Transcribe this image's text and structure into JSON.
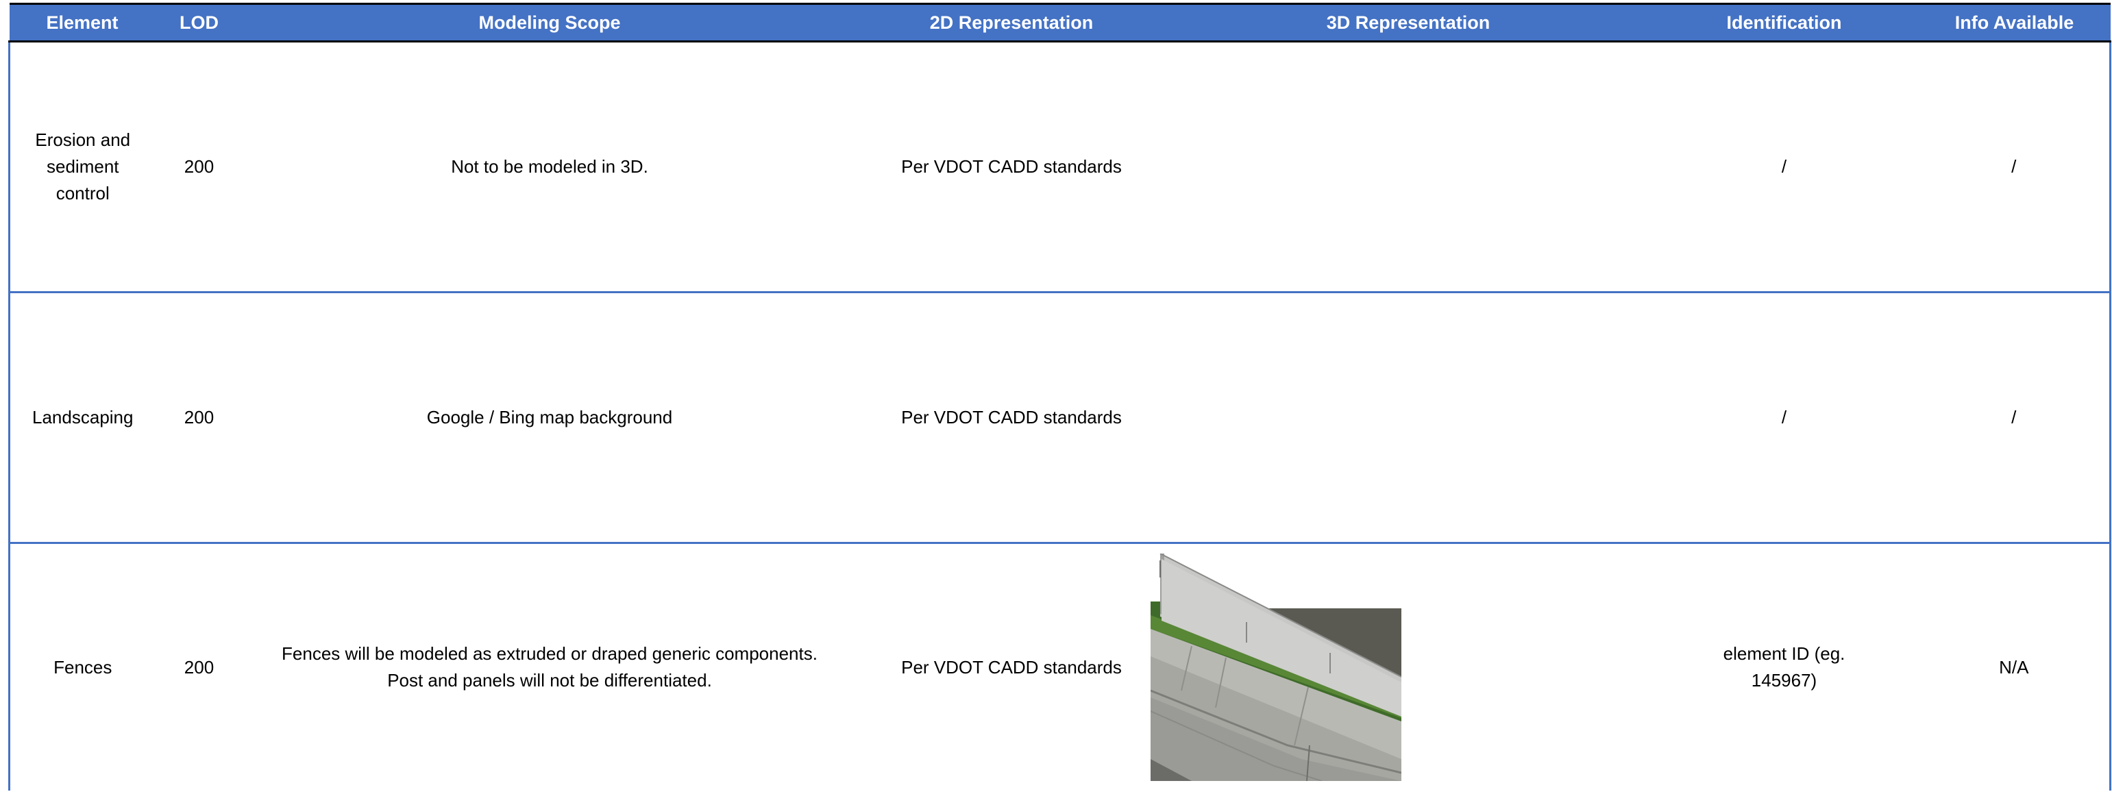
{
  "table": {
    "headers": [
      "Element",
      "LOD",
      "Modeling Scope",
      "2D Representation",
      "3D Representation",
      "Identification",
      "Info Available"
    ],
    "rows": [
      {
        "element": "Erosion and sediment control",
        "lod": "200",
        "scope": "Not to be modeled in 3D.",
        "rep2d": "Per VDOT CADD standards",
        "rep3d": "",
        "identification": "/",
        "info": "/"
      },
      {
        "element": "Landscaping",
        "lod": "200",
        "scope": "Google / Bing map background",
        "rep2d": "Per VDOT CADD standards",
        "rep3d": "",
        "identification": "/",
        "info": "/"
      },
      {
        "element": "Fences",
        "lod": "200",
        "scope": "Fences will be modeled as extruded or draped generic components. Post and panels will not be differentiated.",
        "rep2d": "Per VDOT CADD standards",
        "rep3d": "fence-3d-render-image",
        "identification": "element ID (eg. 145967)",
        "info": "N/A"
      }
    ]
  },
  "colors": {
    "header_bg": "#4472c4",
    "header_text": "#ffffff",
    "grid_line": "#4472c4"
  }
}
